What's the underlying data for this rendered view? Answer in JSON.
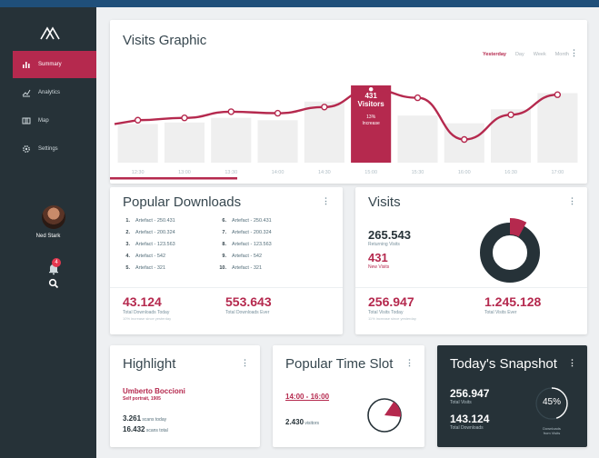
{
  "sidebar": {
    "items": [
      {
        "label": "Summary",
        "icon": "bar-chart-icon"
      },
      {
        "label": "Analytics",
        "icon": "analytics-icon"
      },
      {
        "label": "Map",
        "icon": "map-icon"
      },
      {
        "label": "Settings",
        "icon": "gear-icon"
      }
    ],
    "active_index": 0,
    "user_name": "Ned Stark",
    "notification_count": "4"
  },
  "visits_graphic": {
    "title": "Visits Graphic",
    "tabs": [
      "Yesterday",
      "Day",
      "Week",
      "Month"
    ],
    "active_tab": "Yesterday",
    "menu_glyph": "⋮",
    "highlight": {
      "value": "431",
      "label": "Visitors",
      "percent": "13%",
      "percent_label": "Increase"
    }
  },
  "chart_data": {
    "type": "bar",
    "categories": [
      "12:30",
      "13:00",
      "13:30",
      "14:00",
      "14:30",
      "15:00",
      "15:30",
      "16:00",
      "16:30",
      "17:00"
    ],
    "bar_values": [
      50,
      52,
      58,
      55,
      79,
      100,
      61,
      51,
      69,
      90
    ],
    "line_values": [
      55,
      58,
      66,
      64,
      72,
      95,
      84,
      30,
      62,
      88
    ],
    "highlighted_index": 5,
    "ylim": [
      0,
      100
    ],
    "colors": {
      "bar": "#efefef",
      "highlight_bar": "#b5294e",
      "line": "#b5294e"
    }
  },
  "popular_downloads": {
    "title": "Popular Downloads",
    "menu_glyph": "⋮",
    "items": [
      {
        "n": "1.",
        "name": "Artefact - 250.431"
      },
      {
        "n": "2.",
        "name": "Artefact - 200.324"
      },
      {
        "n": "3.",
        "name": "Artefact - 123.563"
      },
      {
        "n": "4.",
        "name": "Artefact - 542"
      },
      {
        "n": "5.",
        "name": "Artefact - 321"
      },
      {
        "n": "6.",
        "name": "Artefact - 250.431"
      },
      {
        "n": "7.",
        "name": "Artefact - 200.324"
      },
      {
        "n": "8.",
        "name": "Artefact - 123.563"
      },
      {
        "n": "9.",
        "name": "Artefact - 542"
      },
      {
        "n": "10.",
        "name": "Artefact - 321"
      }
    ],
    "today_value": "43.124",
    "today_label": "Total Downloads Today",
    "today_note": "10% increase since yesterday",
    "ever_value": "553.643",
    "ever_label": "Total Downloads Ever"
  },
  "visits": {
    "title": "Visits",
    "menu_glyph": "⋮",
    "returning_value": "265.543",
    "returning_label": "Returning Visits",
    "new_value": "431",
    "new_label": "New Visits",
    "today_value": "256.947",
    "today_label": "Total Visits Today",
    "today_note": "11% increase since yesterday",
    "ever_value": "1.245.128",
    "ever_label": "Total Visits Ever",
    "donut_new_fraction": 0.08,
    "colors": {
      "returning": "#263238",
      "new": "#b5294e"
    }
  },
  "highlight": {
    "title": "Highlight",
    "menu_glyph": "⋮",
    "name": "Umberto Boccioni",
    "subtitle": "Self portrait, 1905",
    "scans_today_value": "3.261",
    "scans_today_label": "scans today",
    "scans_total_value": "16.432",
    "scans_total_label": "scans total"
  },
  "popular_time_slot": {
    "title": "Popular Time Slot",
    "menu_glyph": "⋮",
    "slot": "14:00 - 16:00",
    "visitors_value": "2.430",
    "visitors_label": "visitors",
    "slot_fraction": 0.17
  },
  "snapshot": {
    "title": "Today's Snapshot",
    "menu_glyph": "⋮",
    "visits_value": "256.947",
    "visits_label": "Total Visits",
    "downloads_value": "143.124",
    "downloads_label": "Total Downloads",
    "percent": "45%",
    "percent_fraction": 0.45,
    "percent_label_1": "Downloads",
    "percent_label_2": "from Visits"
  }
}
